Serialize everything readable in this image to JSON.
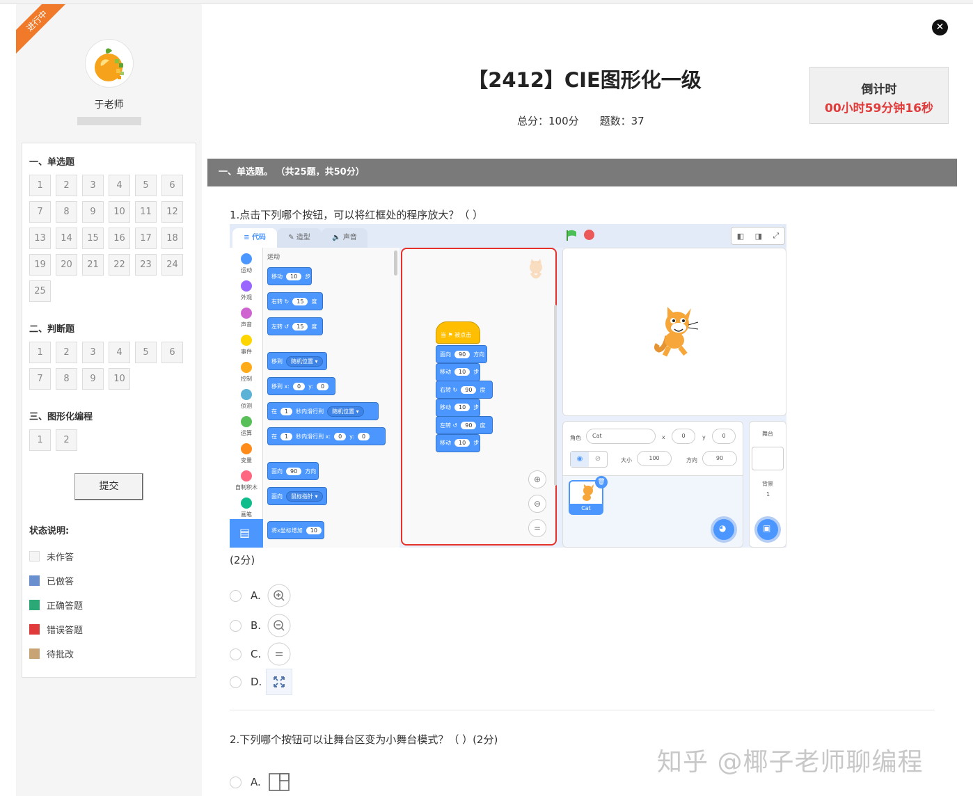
{
  "sidebar": {
    "ribbon": "进行中",
    "teacher_name": "于老师",
    "sections": [
      {
        "title": "一、单选题",
        "items": [
          "1",
          "2",
          "3",
          "4",
          "5",
          "6",
          "7",
          "8",
          "9",
          "10",
          "11",
          "12",
          "13",
          "14",
          "15",
          "16",
          "17",
          "18",
          "19",
          "20",
          "21",
          "22",
          "23",
          "24",
          "25"
        ]
      },
      {
        "title": "二、判断题",
        "items": [
          "1",
          "2",
          "3",
          "4",
          "5",
          "6",
          "7",
          "8",
          "9",
          "10"
        ]
      },
      {
        "title": "三、图形化编程",
        "items": [
          "1",
          "2"
        ]
      }
    ],
    "submit_label": "提交",
    "legend_title": "状态说明:",
    "legend": [
      {
        "label": "未作答",
        "color": "#f5f5f5"
      },
      {
        "label": "已做答",
        "color": "#6a8fcf"
      },
      {
        "label": "正确答题",
        "color": "#2aa876"
      },
      {
        "label": "错误答题",
        "color": "#e03a3a"
      },
      {
        "label": "待批改",
        "color": "#c8a474"
      }
    ]
  },
  "header": {
    "title": "【2412】CIE图形化一级",
    "total_score": "总分：100分",
    "question_count": "题数：37",
    "timer_label": "倒计时",
    "timer_value": "00小时59分钟16秒"
  },
  "section": {
    "title": "一、单选题。 （共25题，共50分）"
  },
  "question1": {
    "text": "1.点击下列哪个按钮，可以将红框处的程序放大？（ ）",
    "score": "(2分)",
    "options": [
      {
        "label": "A.",
        "icon": "zoom-in-icon"
      },
      {
        "label": "B.",
        "icon": "zoom-out-icon"
      },
      {
        "label": "C.",
        "icon": "zoom-reset-icon"
      },
      {
        "label": "D.",
        "icon": "fullscreen-icon"
      }
    ]
  },
  "question2": {
    "text": "2.下列哪个按钮可以让舞台区变为小舞台模式？（ ）(2分)",
    "options": [
      {
        "label": "A.",
        "icon": "small-stage-icon"
      }
    ]
  },
  "scratch": {
    "tabs": [
      "代码",
      "造型",
      "声音"
    ],
    "categories": [
      "运动",
      "外观",
      "声音",
      "事件",
      "控制",
      "侦测",
      "运算",
      "变量",
      "自制积木",
      "画笔"
    ],
    "category_colors": [
      "#4c97ff",
      "#9966ff",
      "#cf63cf",
      "#ffd500",
      "#ffab19",
      "#5cb1d6",
      "#59c059",
      "#ff8c1a",
      "#ff6680",
      "#0fbd8c"
    ],
    "palette_heading": "运动",
    "palette_blocks": [
      {
        "t1": "移动",
        "v": "10",
        "t2": "步"
      },
      {
        "t1": "右转 ↻",
        "v": "15",
        "t2": "度"
      },
      {
        "t1": "左转 ↺",
        "v": "15",
        "t2": "度"
      },
      {
        "t1": "移到",
        "v": "随机位置 ▾",
        "t2": ""
      },
      {
        "t1": "移到 x:",
        "v": "0",
        "t2": "y:",
        "v2": "0"
      },
      {
        "t1": "在",
        "v": "1",
        "t2": "秒内滑行到",
        "v2": "随机位置 ▾"
      },
      {
        "t1": "在",
        "v": "1",
        "t2": "秒内滑行到 x:",
        "v2": "0",
        "t3": "y:",
        "v3": "0"
      },
      {
        "t1": "面向",
        "v": "90",
        "t2": "方向"
      },
      {
        "t1": "面向",
        "v": "鼠标指针 ▾",
        "t2": ""
      },
      {
        "t1": "将x坐标增加",
        "v": "10",
        "t2": ""
      }
    ],
    "hat_label": "当 ⚑ 被点击",
    "script_blocks": [
      {
        "t1": "面向",
        "v": "90",
        "t2": "方向"
      },
      {
        "t1": "移动",
        "v": "10",
        "t2": "步"
      },
      {
        "t1": "右转 ↻",
        "v": "90",
        "t2": "度"
      },
      {
        "t1": "移动",
        "v": "10",
        "t2": "步"
      },
      {
        "t1": "左转 ↺",
        "v": "90",
        "t2": "度"
      },
      {
        "t1": "移动",
        "v": "10",
        "t2": "步"
      }
    ],
    "sprite_label": "角色",
    "sprite_name": "Cat",
    "x_label": "x",
    "x_value": "0",
    "y_label": "y",
    "y_value": "0",
    "size_label": "大小",
    "size_value": "100",
    "dir_label": "方向",
    "dir_value": "90",
    "stage_label": "舞台",
    "backdrop_label": "背景",
    "backdrop_count": "1",
    "sprite_thumb_label": "Cat"
  },
  "watermark": "知乎 @椰子老师聊编程"
}
